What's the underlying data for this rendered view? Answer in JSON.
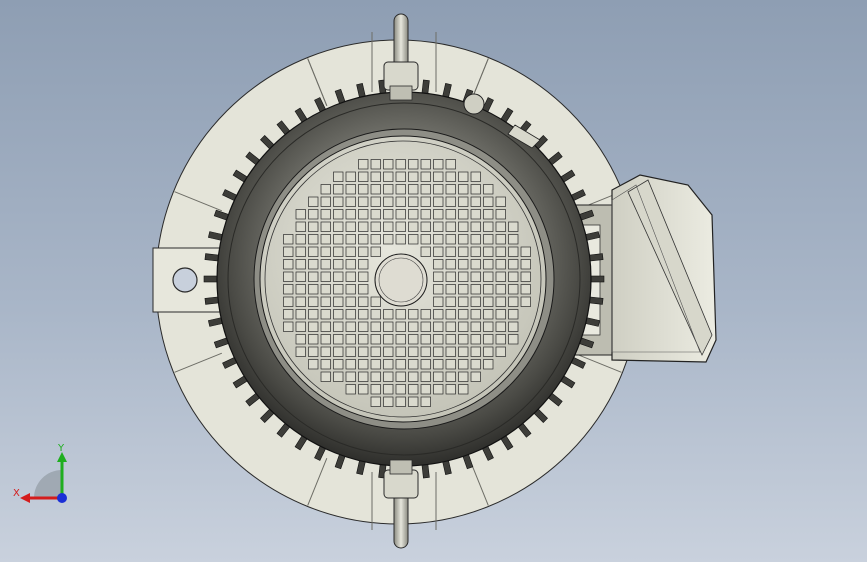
{
  "viewport": {
    "background_top": "#8e9eb3",
    "background_bottom": "#c9d1dd"
  },
  "model": {
    "part": "electric-motor",
    "view": "front",
    "flange_color": "#e4e4d9",
    "housing_color": "#5e5e58",
    "fan_cover_color": "#dcdcd0",
    "terminal_box_color": "#e2e2d6",
    "lifting_eye_color": "#c9c9bb",
    "edge_color": "#1c1c1c"
  },
  "triad": {
    "x_label": "X",
    "y_label": "Y",
    "x_color": "#d41c1c",
    "y_color": "#1fae1f",
    "z_color": "#1b2fd6"
  }
}
